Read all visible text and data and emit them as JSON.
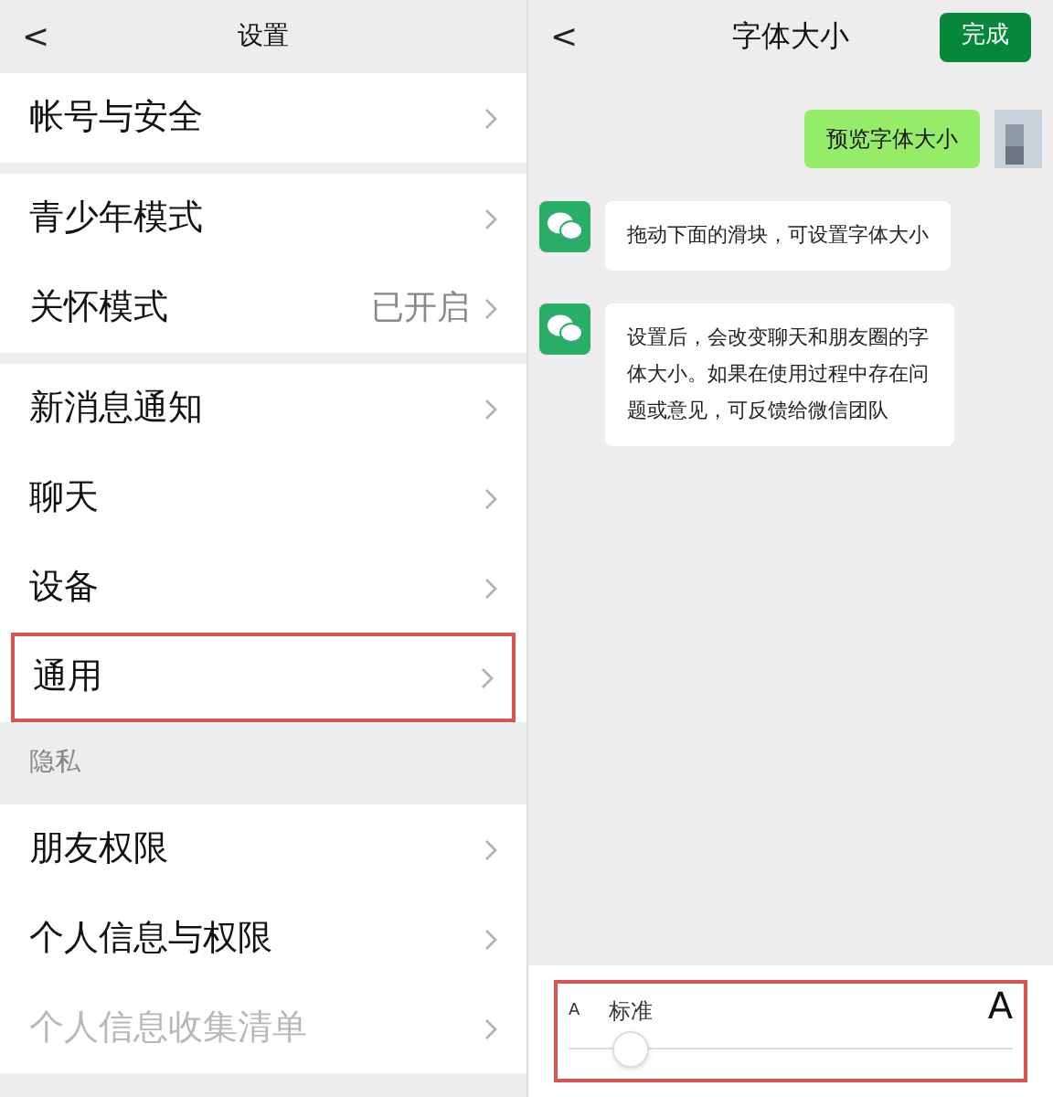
{
  "settings": {
    "title": "设置",
    "back": "<",
    "groups": [
      {
        "items": [
          {
            "label": "帐号与安全",
            "highlighted": false,
            "disabled": false
          }
        ]
      },
      {
        "items": [
          {
            "label": "青少年模式",
            "highlighted": false,
            "disabled": false
          },
          {
            "label": "关怀模式",
            "value": "已开启",
            "highlighted": false,
            "disabled": false
          }
        ]
      },
      {
        "items": [
          {
            "label": "新消息通知",
            "highlighted": false,
            "disabled": false
          },
          {
            "label": "聊天",
            "highlighted": false,
            "disabled": false
          },
          {
            "label": "设备",
            "highlighted": false,
            "disabled": false
          },
          {
            "label": "通用",
            "highlighted": true,
            "disabled": false
          }
        ]
      },
      {
        "header": "隐私",
        "items": [
          {
            "label": "朋友权限",
            "highlighted": false,
            "disabled": false
          },
          {
            "label": "个人信息与权限",
            "highlighted": false,
            "disabled": false
          },
          {
            "label": "个人信息收集清单",
            "highlighted": false,
            "disabled": true
          }
        ]
      }
    ]
  },
  "font_size": {
    "title": "字体大小",
    "back": "<",
    "done": "完成",
    "messages": [
      {
        "kind": "outgoing",
        "text": "预览字体大小"
      },
      {
        "kind": "incoming",
        "text": "拖动下面的滑块，可设置字体大小"
      },
      {
        "kind": "incoming",
        "text": "设置后，会改变聊天和朋友圈的字体大小。如果在使用过程中存在问题或意见，可反馈给微信团队"
      }
    ],
    "slider": {
      "small": "A",
      "label": "标准",
      "large": "A",
      "level": 0.14,
      "highlighted": true
    }
  }
}
